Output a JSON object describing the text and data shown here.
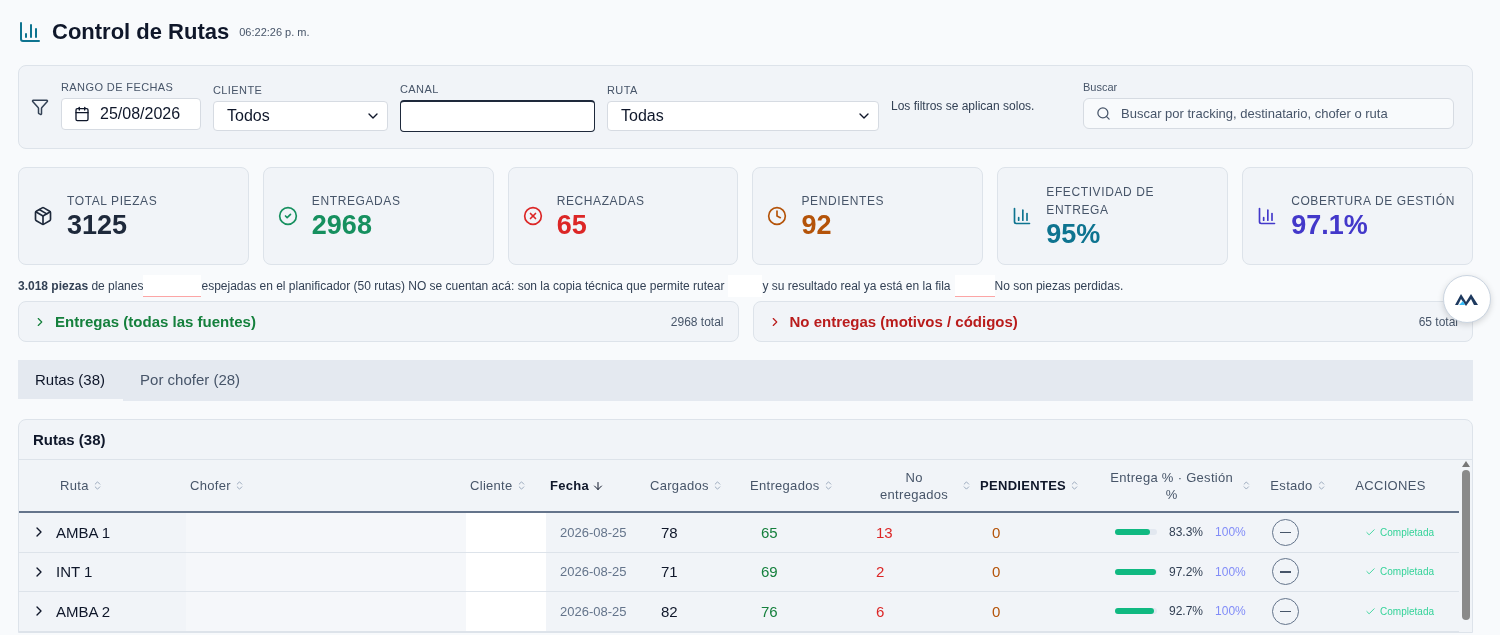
{
  "header": {
    "title": "Control de Rutas",
    "time": "06:22:26 p. m."
  },
  "filters": {
    "date": {
      "label": "RANGO DE FECHAS",
      "value": "25/08/2026"
    },
    "cliente": {
      "label": "CLIENTE",
      "value": "Todos"
    },
    "canal": {
      "label": "CANAL"
    },
    "ruta": {
      "label": "RUTA",
      "value": "Todas"
    },
    "hint": "Los filtros se aplican solos.",
    "search": {
      "label": "Buscar",
      "placeholder": "Buscar por tracking, destinatario, chofer o ruta"
    }
  },
  "kpis": [
    {
      "kind": "box",
      "label": "TOTAL PIEZAS",
      "value": "3125",
      "color": "#1e293b"
    },
    {
      "kind": "check",
      "label": "ENTREGADAS",
      "value": "2968",
      "color": "#16905f"
    },
    {
      "kind": "cross",
      "label": "RECHAZADAS",
      "value": "65",
      "color": "#dc2626"
    },
    {
      "kind": "clock",
      "label": "PENDIENTES",
      "value": "92",
      "color": "#b45309"
    },
    {
      "kind": "chart",
      "label": "EFECTIVIDAD DE ENTREGA",
      "value": "95%",
      "color": "#0e7490"
    },
    {
      "kind": "chart",
      "label": "COBERTURA DE GESTIÓN",
      "value": "97.1%",
      "color": "#4338ca"
    }
  ],
  "note": [
    "**3.018 piezas** de planes",
    "espejadas en el planificador (50 rutas) NO se cuentan acá: son la copia técnica que permite rutear",
    "y su resultado real ya está en la fila",
    "No son piezas perdidas."
  ],
  "accordions": [
    {
      "title": "Entregas (todas las fuentes)",
      "total": "2968 total",
      "expanded": false,
      "color": "#15803d"
    },
    {
      "title": "No entregas (motivos / códigos)",
      "total": "65 total",
      "expanded": false,
      "color": "#b91c1c"
    }
  ],
  "tabs": [
    {
      "label": "Rutas (38)",
      "selected": true
    },
    {
      "label": "Por chofer (28)",
      "selected": false
    }
  ],
  "table": {
    "title": "Rutas (38)",
    "columns": [
      {
        "label": "Ruta",
        "sorted": false,
        "emphasis": false
      },
      {
        "label": "Chofer",
        "sorted": false,
        "emphasis": false
      },
      {
        "label": "Cliente",
        "sorted": false,
        "emphasis": false
      },
      {
        "label": "Fecha",
        "sorted": true,
        "emphasis": true
      },
      {
        "label": "Cargados",
        "sorted": false,
        "emphasis": false
      },
      {
        "label": "Entregados",
        "sorted": false,
        "emphasis": false
      },
      {
        "label": "No entregados",
        "sorted": false,
        "emphasis": false
      },
      {
        "label": "PENDIENTES",
        "sorted": false,
        "emphasis": true
      },
      {
        "label": "Entrega % · Gestión %",
        "sorted": false,
        "emphasis": false
      },
      {
        "label": "Estado",
        "sorted": false,
        "emphasis": false
      },
      {
        "label": "ACCIONES",
        "emphasis": false
      }
    ],
    "rows": [
      {
        "ruta": "AMBA 1",
        "fecha": "2026-08-25",
        "cargados": "78",
        "entregados": "65",
        "no_entregados": "13",
        "pendientes": "0",
        "entrega": "83.3%",
        "level": 0.833,
        "gestion": "100%",
        "accion": "Completada",
        "expanded": false
      },
      {
        "ruta": "INT 1",
        "fecha": "2026-08-25",
        "cargados": "71",
        "entregados": "69",
        "no_entregados": "2",
        "pendientes": "0",
        "entrega": "97.2%",
        "level": 0.972,
        "gestion": "100%",
        "accion": "Completada",
        "expanded": false
      },
      {
        "ruta": "AMBA 2",
        "fecha": "2026-08-25",
        "cargados": "82",
        "entregados": "76",
        "no_entregados": "6",
        "pendientes": "0",
        "entrega": "92.7%",
        "level": 0.927,
        "gestion": "100%",
        "accion": "Completada",
        "expanded": false
      }
    ]
  }
}
